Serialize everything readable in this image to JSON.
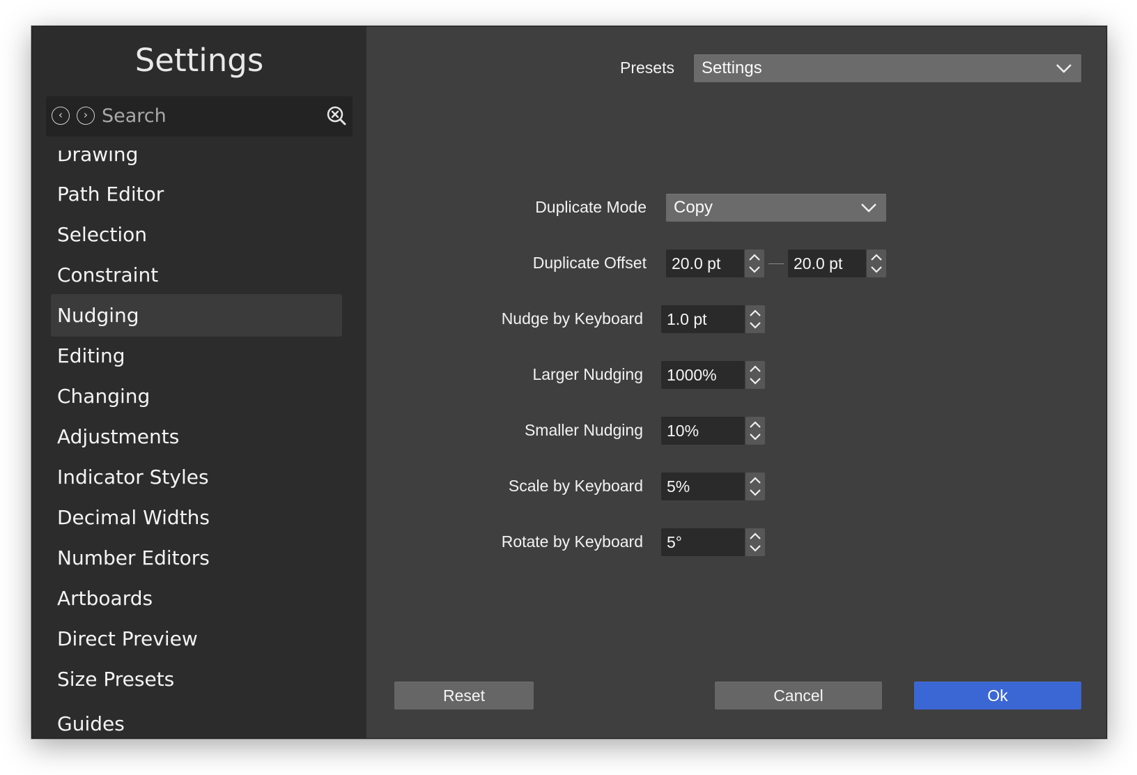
{
  "sidebar": {
    "title": "Settings",
    "search": {
      "placeholder": "Search",
      "value": ""
    },
    "items": [
      {
        "label": "Drawing"
      },
      {
        "label": "Path Editor"
      },
      {
        "label": "Selection"
      },
      {
        "label": "Constraint"
      },
      {
        "label": "Nudging",
        "active": true
      },
      {
        "label": "Editing"
      },
      {
        "label": "Changing"
      },
      {
        "label": "Adjustments"
      },
      {
        "label": "Indicator Styles"
      },
      {
        "label": "Decimal Widths"
      },
      {
        "label": "Number Editors"
      },
      {
        "label": "Artboards"
      },
      {
        "label": "Direct Preview"
      },
      {
        "label": "Size Presets"
      },
      {
        "label": "Guides"
      }
    ]
  },
  "presets": {
    "label": "Presets",
    "value": "Settings"
  },
  "form": {
    "duplicate_mode": {
      "label": "Duplicate Mode",
      "value": "Copy"
    },
    "duplicate_offset": {
      "label": "Duplicate Offset",
      "x": "20.0 pt",
      "y": "20.0 pt"
    },
    "nudge_by_keyboard": {
      "label": "Nudge by Keyboard",
      "value": "1.0 pt"
    },
    "larger_nudging": {
      "label": "Larger Nudging",
      "value": "1000%"
    },
    "smaller_nudging": {
      "label": "Smaller Nudging",
      "value": "10%"
    },
    "scale_by_keyboard": {
      "label": "Scale by Keyboard",
      "value": "5%"
    },
    "rotate_by_keyboard": {
      "label": "Rotate by Keyboard",
      "value": "5°"
    }
  },
  "buttons": {
    "reset": "Reset",
    "cancel": "Cancel",
    "ok": "Ok"
  },
  "colors": {
    "sidebar_bg": "#2c2c2c",
    "panel_bg": "#3f3f3f",
    "primary_button": "#3b67d4"
  },
  "icons": {
    "back": "chevron-left-icon",
    "forward": "chevron-right-icon",
    "search_clear": "search-clear-icon",
    "dropdown": "chevron-down-icon",
    "stepper": "up-down-stepper-icon"
  }
}
